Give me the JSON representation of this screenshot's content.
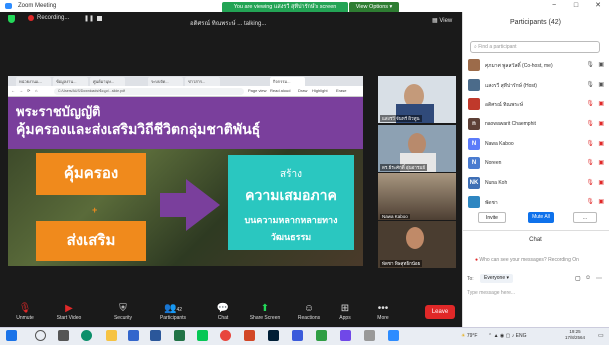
{
  "window": {
    "title": "Zoom Meeting"
  },
  "banner": {
    "viewing": "You are viewing แสงรวี สุทีปารักษ์'s screen",
    "view_options": "View Options ▾"
  },
  "meeting": {
    "recording": "Recording...",
    "talking": "อดิศรณ์ ทิณพระษ์ ... talking...",
    "view_label": "View"
  },
  "browser": {
    "tabs": [
      "หน่วยงานแ...",
      "ข้อมูลงาน...",
      "ศูนย์มานุษ...",
      "ระบบจัด...",
      "ข่าวสาร...",
      "กิจกรรม..."
    ],
    "url": "C:/Users/AUS/Downloads/ข้อมูล/...slide.pdf",
    "pdf_buttons": [
      "Page view",
      "Read aloud",
      "Draw",
      "Highlight",
      "Erase"
    ]
  },
  "slide": {
    "line1": "พระราชบัญญัติ",
    "line2": "คุ้มครองและส่งเสริมวิถีชีวิตกลุ่มชาติพันธุ์",
    "box1": "คุ้มครอง",
    "plus": "+",
    "box2": "ส่งเสริม",
    "teal_title": "สร้าง",
    "teal_main": "ความเสมอภาค",
    "teal_sub1": "บนความหลากหลายทาง",
    "teal_sub2": "วัฒนธรรม"
  },
  "video_tiles": [
    {
      "label": "แสงรวี จันทร์ ผิวทูน"
    },
    {
      "label": "ดร.ธีระศักดิ์ อุ่นอารมย์"
    },
    {
      "label": "Nawa Kaboo"
    },
    {
      "label": "พัดชา พิษสุทธิกน้อย"
    }
  ],
  "toolbar": {
    "items": [
      "Unmute",
      "Start Video",
      "Security",
      "Participants",
      "Chat",
      "Share Screen",
      "Reactions",
      "Apps",
      "More"
    ],
    "participants_count": "42",
    "leave": "Leave"
  },
  "participants": {
    "title": "Participants (42)",
    "search_placeholder": "Find a participant",
    "list": [
      {
        "initials": "",
        "name": "ศุภมาศ พูลสวัสดิ์ (Co-host, me)",
        "color": "#9c6b4a"
      },
      {
        "initials": "",
        "name": "แสงรวี สุทีปารักษ์ (Host)",
        "color": "#4b6b8a"
      },
      {
        "initials": "",
        "name": "อดิศรณ์ ทิณพระษ์",
        "color": "#c0392b"
      },
      {
        "initials": "n",
        "name": "naowawarit Chaemphit",
        "color": "#5d4037"
      },
      {
        "initials": "N",
        "name": "Nawa Kaboo",
        "color": "#5c7cfa"
      },
      {
        "initials": "N",
        "name": "Noreen",
        "color": "#4a7bd0"
      },
      {
        "initials": "NK",
        "name": "Nuna Koh",
        "color": "#3f6fb5"
      },
      {
        "initials": "",
        "name": "พัดชา",
        "color": "#2e86c1"
      }
    ],
    "invite": "Invite",
    "mute_all": "Mute All",
    "more": "..."
  },
  "chat": {
    "title": "Chat",
    "notice": "Who can see your messages? Recording On",
    "to_label": "To:",
    "recipient": "Everyone ▾",
    "input_placeholder": "Type message here..."
  },
  "taskbar": {
    "weather": "79°F",
    "time": "19:25",
    "date": "17/8/2564"
  }
}
